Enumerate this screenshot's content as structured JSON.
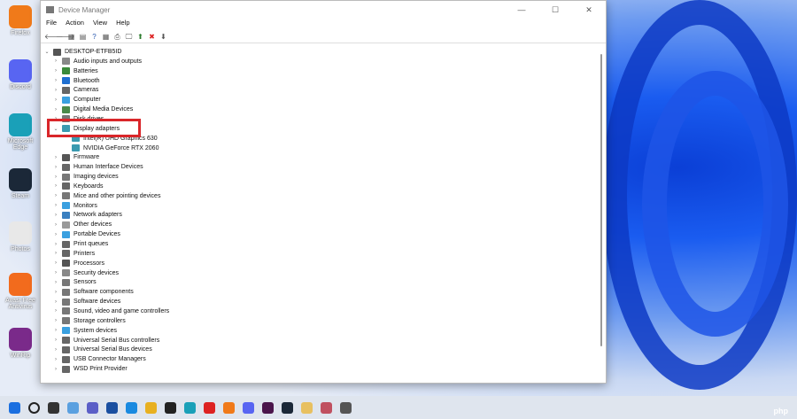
{
  "desktop": {
    "icons": [
      {
        "label": "Firefox",
        "color": "#f07a1a"
      },
      {
        "label": "Discord",
        "color": "#5865f2"
      },
      {
        "label": "Microsoft Edge",
        "color": "#1aa0b8"
      },
      {
        "label": "Steam",
        "color": "#1b2838"
      },
      {
        "label": "Photos",
        "color": "#e8e8e8"
      },
      {
        "label": "Avast Free Antivirus",
        "color": "#f26b1d"
      },
      {
        "label": "WinRip",
        "color": "#7a2a8a"
      }
    ]
  },
  "window": {
    "title": "Device Manager",
    "menu": [
      "File",
      "Action",
      "View",
      "Help"
    ],
    "controls": [
      "—",
      "☐",
      "✕"
    ],
    "toolbar": [
      "🡐",
      "🡒",
      "▦",
      "▤",
      "?",
      "▦",
      "⎙",
      "🖵",
      "⬆",
      "✖",
      "⬇"
    ]
  },
  "tree": {
    "root": "DESKTOP-ETFB5ID",
    "items": [
      {
        "label": "Audio inputs and outputs",
        "color": "#888"
      },
      {
        "label": "Batteries",
        "color": "#3a8a3a"
      },
      {
        "label": "Bluetooth",
        "color": "#1f6fd0"
      },
      {
        "label": "Cameras",
        "color": "#666"
      },
      {
        "label": "Computer",
        "color": "#3aa0e0"
      },
      {
        "label": "Digital Media Devices",
        "color": "#4a8a4a"
      },
      {
        "label": "Disk drives",
        "color": "#777"
      },
      {
        "label": "Display adapters",
        "color": "#3a9ab0",
        "expanded": true
      },
      {
        "label": "Intel(R) UHD Graphics 630",
        "color": "#3a9ab0",
        "child": true
      },
      {
        "label": "NVIDIA GeForce RTX 2060",
        "color": "#3a9ab0",
        "child": true
      },
      {
        "label": "Firmware",
        "color": "#555"
      },
      {
        "label": "Human Interface Devices",
        "color": "#666"
      },
      {
        "label": "Imaging devices",
        "color": "#777"
      },
      {
        "label": "Keyboards",
        "color": "#666"
      },
      {
        "label": "Mice and other pointing devices",
        "color": "#777"
      },
      {
        "label": "Monitors",
        "color": "#3aa0e0"
      },
      {
        "label": "Network adapters",
        "color": "#3a80c0"
      },
      {
        "label": "Other devices",
        "color": "#999"
      },
      {
        "label": "Portable Devices",
        "color": "#3aa0e0"
      },
      {
        "label": "Print queues",
        "color": "#666"
      },
      {
        "label": "Printers",
        "color": "#666"
      },
      {
        "label": "Processors",
        "color": "#555"
      },
      {
        "label": "Security devices",
        "color": "#888"
      },
      {
        "label": "Sensors",
        "color": "#777"
      },
      {
        "label": "Software components",
        "color": "#777"
      },
      {
        "label": "Software devices",
        "color": "#777"
      },
      {
        "label": "Sound, video and game controllers",
        "color": "#777"
      },
      {
        "label": "Storage controllers",
        "color": "#777"
      },
      {
        "label": "System devices",
        "color": "#3aa0e0"
      },
      {
        "label": "Universal Serial Bus controllers",
        "color": "#666"
      },
      {
        "label": "Universal Serial Bus devices",
        "color": "#666"
      },
      {
        "label": "USB Connector Managers",
        "color": "#666"
      },
      {
        "label": "WSD Print Provider",
        "color": "#666"
      }
    ]
  },
  "taskbar": {
    "icons": [
      "start",
      "search",
      "task-view",
      "widgets",
      "teams",
      "store",
      "mail",
      "explorer",
      "app",
      "edge",
      "wps",
      "firefox",
      "discord",
      "slack",
      "steam",
      "app2",
      "snipping",
      "app3"
    ],
    "watermark": "php"
  }
}
